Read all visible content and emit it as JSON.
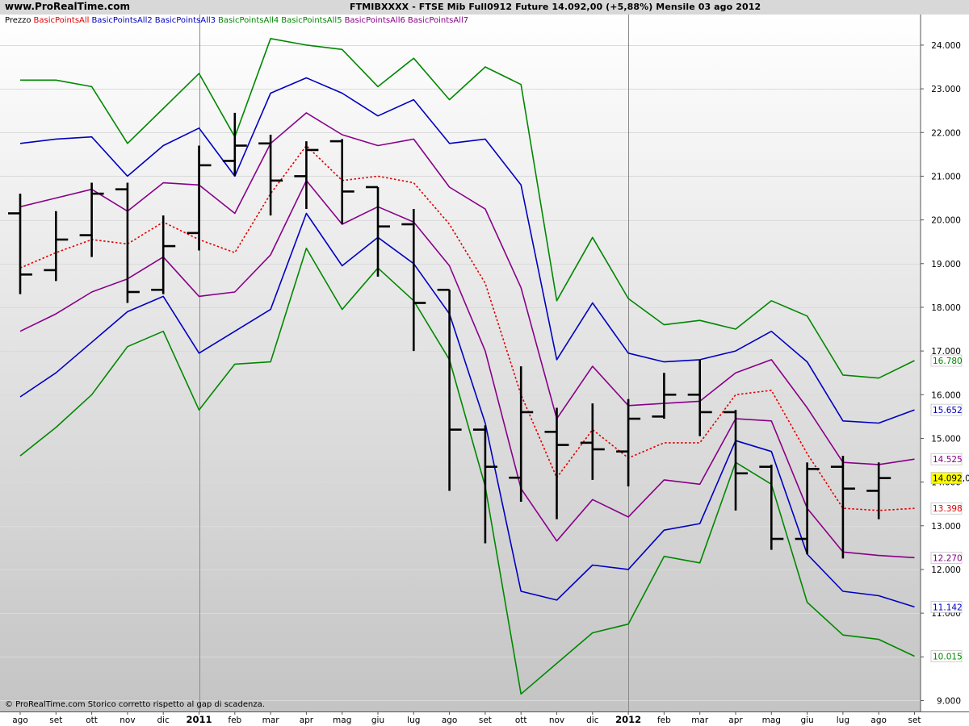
{
  "header": {
    "site": "www.ProRealTime.com",
    "title": "FTMIBXXXX - FTSE Mib Full0912 Future    14.092,00 (+5,88%)    Mensile  03 ago 2012"
  },
  "legend": [
    {
      "name": "Prezzo",
      "color": "#000000"
    },
    {
      "name": "BasicPointsAll",
      "color": "#e00000"
    },
    {
      "name": "BasicPointsAll2",
      "color": "#0000c0"
    },
    {
      "name": "BasicPointsAll3",
      "color": "#0000c0"
    },
    {
      "name": "BasicPointsAll4",
      "color": "#008800"
    },
    {
      "name": "BasicPointsAll5",
      "color": "#008800"
    },
    {
      "name": "BasicPointsAll6",
      "color": "#880088"
    },
    {
      "name": "BasicPointsAll7",
      "color": "#880088"
    }
  ],
  "footer": "© ProRealTime.com  Storico corretto rispetto al gap di scadenza.",
  "chart_data": {
    "type": "ohlc",
    "ylim": [
      8750,
      24700
    ],
    "y_ticks": [
      {
        "value": 9000,
        "label": "9.000"
      },
      {
        "value": 10000,
        "label": "10.000"
      },
      {
        "value": 11000,
        "label": "11.000"
      },
      {
        "value": 12000,
        "label": "12.000"
      },
      {
        "value": 13000,
        "label": "13.000"
      },
      {
        "value": 14000,
        "label": "14.000"
      },
      {
        "value": 15000,
        "label": "15.000"
      },
      {
        "value": 16000,
        "label": "16.000"
      },
      {
        "value": 17000,
        "label": "17.000"
      },
      {
        "value": 18000,
        "label": "18.000"
      },
      {
        "value": 19000,
        "label": "19.000"
      },
      {
        "value": 20000,
        "label": "20.000"
      },
      {
        "value": 21000,
        "label": "21.000"
      },
      {
        "value": 22000,
        "label": "22.000"
      },
      {
        "value": 23000,
        "label": "23.000"
      },
      {
        "value": 24000,
        "label": "24.000"
      }
    ],
    "x_labels": [
      "ago",
      "set",
      "ott",
      "nov",
      "dic",
      "2011",
      "feb",
      "mar",
      "apr",
      "mag",
      "giu",
      "lug",
      "ago",
      "set",
      "ott",
      "nov",
      "dic",
      "2012",
      "feb",
      "mar",
      "apr",
      "mag",
      "giu",
      "lug",
      "ago",
      "set"
    ],
    "x_bold": [
      5,
      17
    ],
    "x_divider_indices": [
      5,
      17
    ],
    "ohlc": [
      {
        "o": 20150,
        "h": 20600,
        "l": 18300,
        "c": 18750
      },
      {
        "o": 18850,
        "h": 20200,
        "l": 18600,
        "c": 19550
      },
      {
        "o": 19650,
        "h": 20850,
        "l": 19150,
        "c": 20600
      },
      {
        "o": 20700,
        "h": 20850,
        "l": 18100,
        "c": 18350
      },
      {
        "o": 18400,
        "h": 20100,
        "l": 18300,
        "c": 19400
      },
      {
        "o": 19700,
        "h": 21700,
        "l": 19300,
        "c": 21250
      },
      {
        "o": 21350,
        "h": 22450,
        "l": 21000,
        "c": 21700
      },
      {
        "o": 21750,
        "h": 21950,
        "l": 20100,
        "c": 20900
      },
      {
        "o": 21000,
        "h": 21800,
        "l": 20250,
        "c": 21600
      },
      {
        "o": 21800,
        "h": 21850,
        "l": 19900,
        "c": 20650
      },
      {
        "o": 20750,
        "h": 20750,
        "l": 18700,
        "c": 19850
      },
      {
        "o": 19900,
        "h": 20250,
        "l": 17000,
        "c": 18100
      },
      {
        "o": 18400,
        "h": 18400,
        "l": 13800,
        "c": 15200
      },
      {
        "o": 15200,
        "h": 15300,
        "l": 12600,
        "c": 14350
      },
      {
        "o": 14100,
        "h": 16650,
        "l": 13550,
        "c": 15600
      },
      {
        "o": 15150,
        "h": 15700,
        "l": 13150,
        "c": 14850
      },
      {
        "o": 14900,
        "h": 15800,
        "l": 14050,
        "c": 14750
      },
      {
        "o": 14700,
        "h": 15900,
        "l": 13900,
        "c": 15450
      },
      {
        "o": 15500,
        "h": 16500,
        "l": 15450,
        "c": 16000
      },
      {
        "o": 16000,
        "h": 16800,
        "l": 15050,
        "c": 15600
      },
      {
        "o": 15600,
        "h": 15650,
        "l": 13350,
        "c": 14200
      },
      {
        "o": 14350,
        "h": 14400,
        "l": 12450,
        "c": 12700
      },
      {
        "o": 12700,
        "h": 14450,
        "l": 12350,
        "c": 14300
      },
      {
        "o": 14350,
        "h": 14600,
        "l": 12250,
        "c": 13850
      },
      {
        "o": 13800,
        "h": 14450,
        "l": 13150,
        "c": 14092
      }
    ],
    "series": [
      {
        "color": "#008800",
        "style": "solid",
        "values": [
          23200,
          23200,
          23050,
          21750,
          22550,
          23350,
          21900,
          24150,
          24000,
          23900,
          23050,
          23700,
          22750,
          23500,
          23100,
          18150,
          19600,
          18200,
          17600,
          17700,
          17500,
          18150,
          17800,
          16450,
          16380,
          16780
        ]
      },
      {
        "color": "#0000c0",
        "style": "solid",
        "values": [
          21750,
          21850,
          21900,
          21000,
          21700,
          22100,
          21000,
          22900,
          23250,
          22900,
          22380,
          22750,
          21750,
          21850,
          20800,
          16800,
          18100,
          16950,
          16750,
          16800,
          17000,
          17450,
          16750,
          15400,
          15350,
          15652
        ]
      },
      {
        "color": "#880088",
        "style": "solid",
        "values": [
          20300,
          20500,
          20700,
          20200,
          20850,
          20800,
          20150,
          21750,
          22450,
          21950,
          21700,
          21850,
          20750,
          20250,
          18450,
          15450,
          16650,
          15750,
          15800,
          15850,
          16500,
          16800,
          15700,
          14450,
          14400,
          14525
        ]
      },
      {
        "color": "#e00000",
        "style": "dotted",
        "values": [
          18900,
          19250,
          19550,
          19450,
          19950,
          19550,
          19250,
          20600,
          21700,
          20900,
          21000,
          20850,
          19900,
          18550,
          16000,
          14100,
          15200,
          14550,
          14900,
          14900,
          16000,
          16100,
          14650,
          13400,
          13350,
          13398
        ]
      },
      {
        "color": "#880088",
        "style": "solid",
        "values": [
          17450,
          17850,
          18350,
          18650,
          19150,
          18250,
          18350,
          19200,
          20900,
          19900,
          20300,
          19950,
          18950,
          17000,
          13850,
          12650,
          13600,
          13200,
          14050,
          13950,
          15450,
          15400,
          13400,
          12400,
          12320,
          12270
        ]
      },
      {
        "color": "#0000c0",
        "style": "solid",
        "values": [
          15950,
          16500,
          17200,
          17900,
          18250,
          16950,
          17450,
          17950,
          20150,
          18950,
          19600,
          19000,
          17850,
          15350,
          11500,
          11300,
          12100,
          12000,
          12900,
          13050,
          14950,
          14700,
          12350,
          11500,
          11400,
          11142
        ]
      },
      {
        "color": "#008800",
        "style": "solid",
        "values": [
          14600,
          15250,
          16000,
          17100,
          17450,
          15650,
          16700,
          16750,
          19350,
          17950,
          18900,
          18150,
          16800,
          13900,
          9150,
          9850,
          10550,
          10750,
          12300,
          12150,
          14450,
          13950,
          11250,
          10500,
          10400,
          10015
        ]
      }
    ],
    "last_values": [
      {
        "label": "16.780",
        "value": 16780,
        "color": "#008800",
        "bg": "#ffffff"
      },
      {
        "label": "15.652",
        "value": 15652,
        "color": "#0000c0",
        "bg": "#ffffff"
      },
      {
        "label": "14.525",
        "value": 14525,
        "color": "#880088",
        "bg": "#ffffff"
      },
      {
        "label": "14.092,0",
        "value": 14092,
        "color": "#000000",
        "bg": "#ffff00"
      },
      {
        "label": "13.398",
        "value": 13398,
        "color": "#e00000",
        "bg": "#ffffff"
      },
      {
        "label": "12.270",
        "value": 12270,
        "color": "#880088",
        "bg": "#ffffff"
      },
      {
        "label": "11.142",
        "value": 11142,
        "color": "#0000c0",
        "bg": "#ffffff"
      },
      {
        "label": "10.015",
        "value": 10015,
        "color": "#008800",
        "bg": "#ffffff"
      }
    ]
  }
}
